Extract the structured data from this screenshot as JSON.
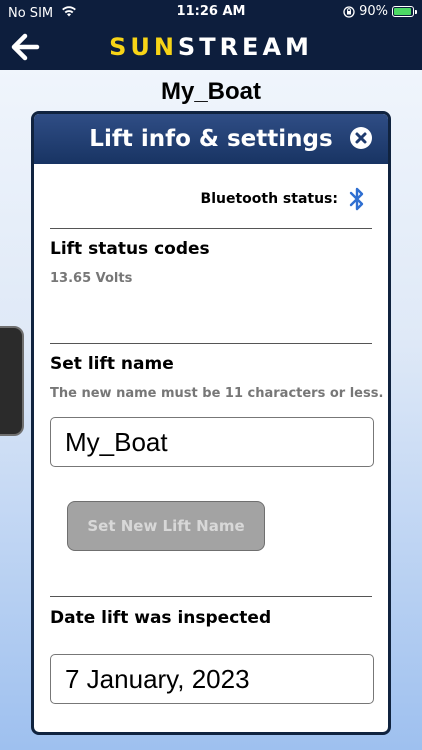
{
  "status_bar": {
    "carrier": "No SIM",
    "time": "11:26 AM",
    "battery_percent": "90%"
  },
  "nav": {
    "brand_part1": "SUN",
    "brand_part2": "STREAM",
    "back_icon": "arrow-left-icon"
  },
  "lift_name": "My_Boat",
  "modal": {
    "title": "Lift info & settings",
    "close_icon": "close-icon",
    "bluetooth_label": "Bluetooth status:",
    "bluetooth_icon": "bluetooth-icon",
    "bluetooth_color": "#2f6fd1",
    "status_codes_title": "Lift status codes",
    "voltage": "13.65 Volts",
    "set_name_title": "Set lift name",
    "set_name_hint": "The new name must be 11 characters or less.",
    "name_value": "My_Boat",
    "set_button_label": "Set New Lift Name",
    "inspected_title": "Date lift was inspected",
    "inspected_value": "7 January, 2023"
  },
  "colors": {
    "navbar": "#0d1e3d",
    "brand_accent": "#f7d417",
    "header": "#1f3b6e"
  }
}
